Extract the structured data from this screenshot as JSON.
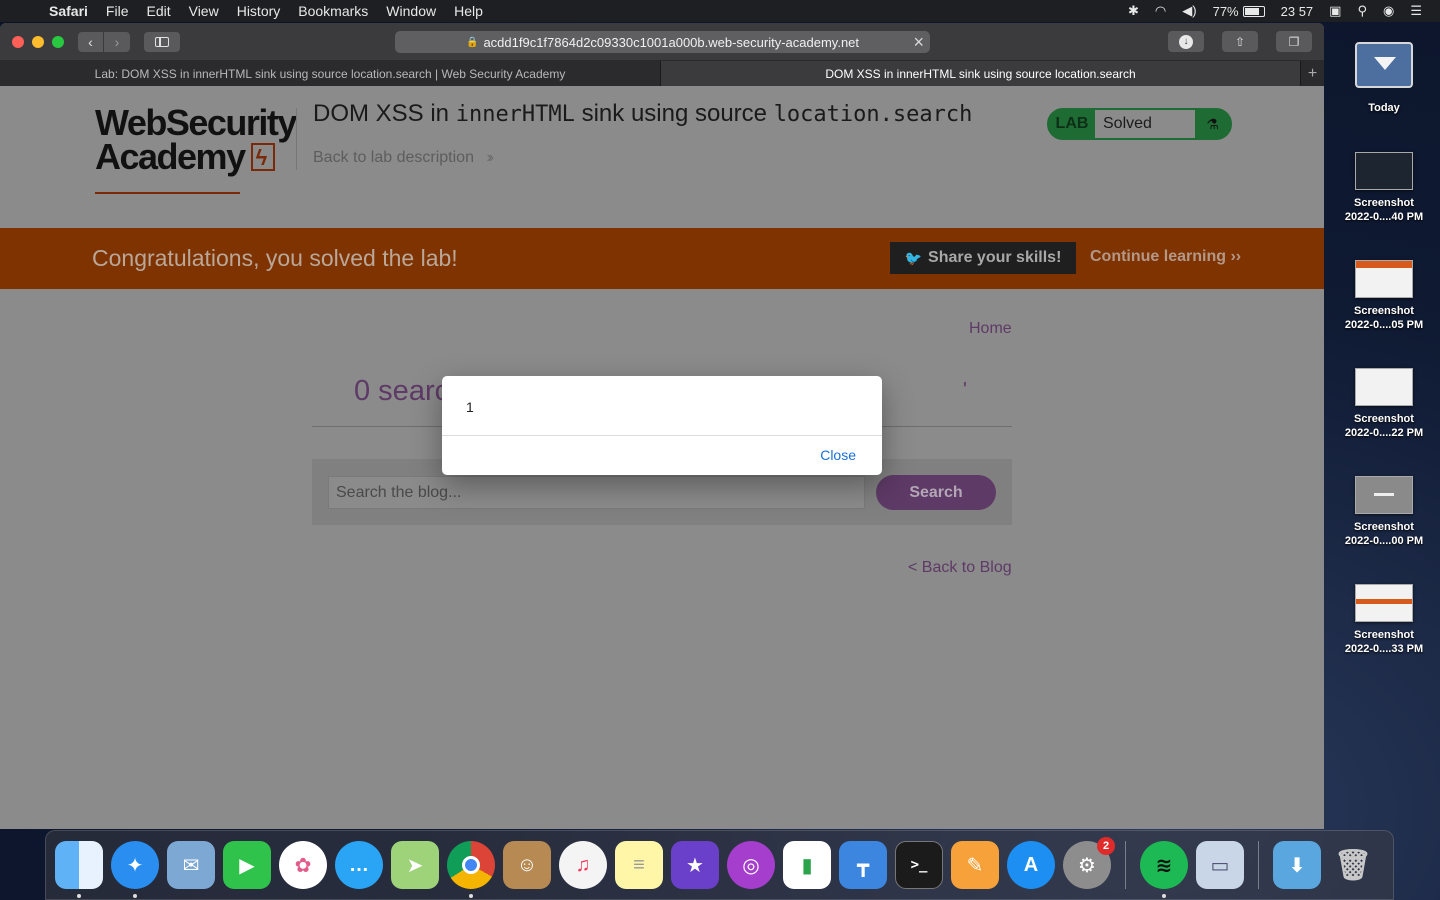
{
  "menubar": {
    "app_name": "Safari",
    "items": [
      "File",
      "Edit",
      "View",
      "History",
      "Bookmarks",
      "Window",
      "Help"
    ],
    "battery": "77%",
    "clock": "23 57"
  },
  "browser": {
    "url": "acdd1f9c1f7864d2c09330c1001a000b.web-security-academy.net",
    "tabs": [
      {
        "title": "Lab: DOM XSS in innerHTML sink using source location.search | Web Security Academy"
      },
      {
        "title": "DOM XSS in innerHTML sink using source location.search"
      }
    ]
  },
  "lab_header": {
    "logo_line1": "WebSecurity",
    "logo_line2": "Academy",
    "title_prefix": "DOM XSS in ",
    "title_code1": "innerHTML",
    "title_middle": " sink using source ",
    "title_code2": "location.search",
    "back_link": "Back to lab description",
    "status_label": "LAB",
    "status_value": "Solved"
  },
  "banner": {
    "message": "Congratulations, you solved the lab!",
    "share_label": "Share your skills!",
    "continue_label": "Continue learning"
  },
  "blog": {
    "home_link": "Home",
    "results_text": "0 search results for '",
    "results_tail": "'",
    "search_placeholder": "Search the blog...",
    "search_button": "Search",
    "back_link": "< Back to Blog"
  },
  "dialog": {
    "message": "1",
    "close_label": "Close"
  },
  "desktop": {
    "folder_label": "Today",
    "screenshots": [
      {
        "line1": "Screenshot",
        "line2": "2022-0....40 PM"
      },
      {
        "line1": "Screenshot",
        "line2": "2022-0....05 PM"
      },
      {
        "line1": "Screenshot",
        "line2": "2022-0....22 PM"
      },
      {
        "line1": "Screenshot",
        "line2": "2022-0....00 PM"
      },
      {
        "line1": "Screenshot",
        "line2": "2022-0....33 PM"
      }
    ]
  },
  "dock": {
    "apps": [
      "finder-icon",
      "safari-icon",
      "mail-icon",
      "facetime-icon",
      "photos-icon",
      "messages-icon",
      "maps-icon",
      "chrome-icon",
      "contacts-icon",
      "music-icon",
      "notes-icon",
      "imovie-icon",
      "podcasts-icon",
      "numbers-icon",
      "keynote-icon",
      "terminal-icon",
      "pages-icon",
      "app-store-icon",
      "system-preferences-icon",
      "spotify-icon",
      "preview-icon",
      "downloads-icon",
      "trash-icon"
    ],
    "system_preferences_badge": "2"
  },
  "colors": {
    "banner": "#7f3300",
    "purple": "#5e3a66",
    "lab_green": "#1e6b34",
    "dialog_link": "#1a6fd6"
  }
}
